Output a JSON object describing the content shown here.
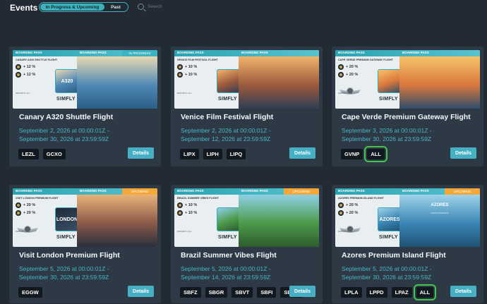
{
  "header": {
    "title": "Events",
    "tab_upcoming": "In Progress & Upcoming",
    "tab_past": "Past",
    "search_placeholder": "Search"
  },
  "banner_common": {
    "boarding_pass": "BOARDING PASS",
    "origin": "DEPARTS: ALL",
    "brand": "SIMFLY"
  },
  "cards": [
    {
      "title": "Canary A320 Shuttle Flight",
      "dates_line1": "September 2, 2026 at 00:00:01Z -",
      "dates_line2": "September 30, 2026 at 23:59:59Z",
      "status": "IN PROGRESS",
      "status_type": "prog",
      "banner_flight": "CANARY A320 SHUTTLE FLIGHT",
      "bonus1": "+ 12 %",
      "bonus2": "+ 12 %",
      "thumb_label": "A320",
      "scene_title": "",
      "scene_sub": "",
      "tags": [
        "LEZL",
        "GCXO"
      ],
      "highlight_tag": -1,
      "details": "Details",
      "has_wings": false,
      "scene_colors": [
        "#e9d9b3",
        "#4f89b5",
        "#2c5e86"
      ]
    },
    {
      "title": "Venice Film Festival Flight",
      "dates_line1": "September 2, 2026 at 00:00:01Z -",
      "dates_line2": "September 12, 2026 at 23:59:59Z",
      "status": "",
      "status_type": "",
      "banner_flight": "VENICE FILM FESTIVAL FLIGHT",
      "bonus1": "+ 10 %",
      "bonus2": "+ 10 %",
      "thumb_label": "",
      "scene_title": "",
      "scene_sub": "",
      "tags": [
        "LIPX",
        "LIPH",
        "LIPQ"
      ],
      "highlight_tag": -1,
      "details": "Details",
      "has_wings": false,
      "scene_colors": [
        "#f0b46b",
        "#9c5a3c",
        "#2f3e55"
      ]
    },
    {
      "title": "Cape Verde Premium Gateway Flight",
      "dates_line1": "September 3, 2026 at 00:00:01Z -",
      "dates_line2": "September 30, 2026 at 23:59:59Z",
      "status": "",
      "status_type": "",
      "banner_flight": "CAPE VERDE PREMIUM GATEWAY FLIGHT",
      "bonus1": "+ 20 %",
      "bonus2": "+ 20 %",
      "thumb_label": "",
      "scene_title": "",
      "scene_sub": "",
      "tags": [
        "GVNP",
        "ALL"
      ],
      "highlight_tag": 1,
      "details": "Details",
      "has_wings": true,
      "scene_colors": [
        "#f7c36a",
        "#d9783d",
        "#2f4d6a"
      ]
    },
    {
      "title": "Visit London Premium Flight",
      "dates_line1": "September 5, 2026 at 00:00:01Z -",
      "dates_line2": "September 30, 2026 at 23:59:59Z",
      "status": "UPCOMING",
      "status_type": "up",
      "banner_flight": "VISIT LONDON PREMIUM FLIGHT",
      "bonus1": "+ 20 %",
      "bonus2": "+ 20 %",
      "thumb_label": "LONDON",
      "scene_title": "",
      "scene_sub": "",
      "tags": [
        "EGGW"
      ],
      "highlight_tag": -1,
      "details": "Details",
      "has_wings": true,
      "scene_colors": [
        "#e9b27a",
        "#8a5a4a",
        "#2a2f3d"
      ]
    },
    {
      "title": "Brazil Summer Vibes Flight",
      "dates_line1": "September 5, 2026 at 00:00:01Z -",
      "dates_line2": "September 14, 2026 at 23:59:59Z",
      "status": "UPCOMING",
      "status_type": "up",
      "banner_flight": "BRAZIL SUMMER VIBES FLIGHT",
      "bonus1": "+ 10 %",
      "bonus2": "+ 10 %",
      "thumb_label": "",
      "scene_title": "",
      "scene_sub": "",
      "tags": [
        "SBFZ",
        "SBGR",
        "SBVT",
        "SBFI",
        "SBSG"
      ],
      "highlight_tag": -1,
      "details": "Details",
      "has_wings": false,
      "scene_colors": [
        "#8fd0e6",
        "#4d9a4a",
        "#2d5b2f"
      ]
    },
    {
      "title": "Azores Premium Island Flight",
      "dates_line1": "September 5, 2026 at 00:00:01Z -",
      "dates_line2": "September 30, 2026 at 23:59:59Z",
      "status": "UPCOMING",
      "status_type": "up",
      "banner_flight": "AZORES PREMIUM ISLAND FLIGHT",
      "bonus1": "+ 20 %",
      "bonus2": "+ 20 %",
      "thumb_label": "AZORES",
      "scene_title": "AZORES",
      "scene_sub": "PORTO MARTINS",
      "tags": [
        "LPLA",
        "LPPD",
        "LPAZ",
        "ALL"
      ],
      "highlight_tag": 3,
      "details": "Details",
      "has_wings": true,
      "scene_colors": [
        "#9fd3ea",
        "#3a86b5",
        "#1e5273"
      ]
    }
  ]
}
